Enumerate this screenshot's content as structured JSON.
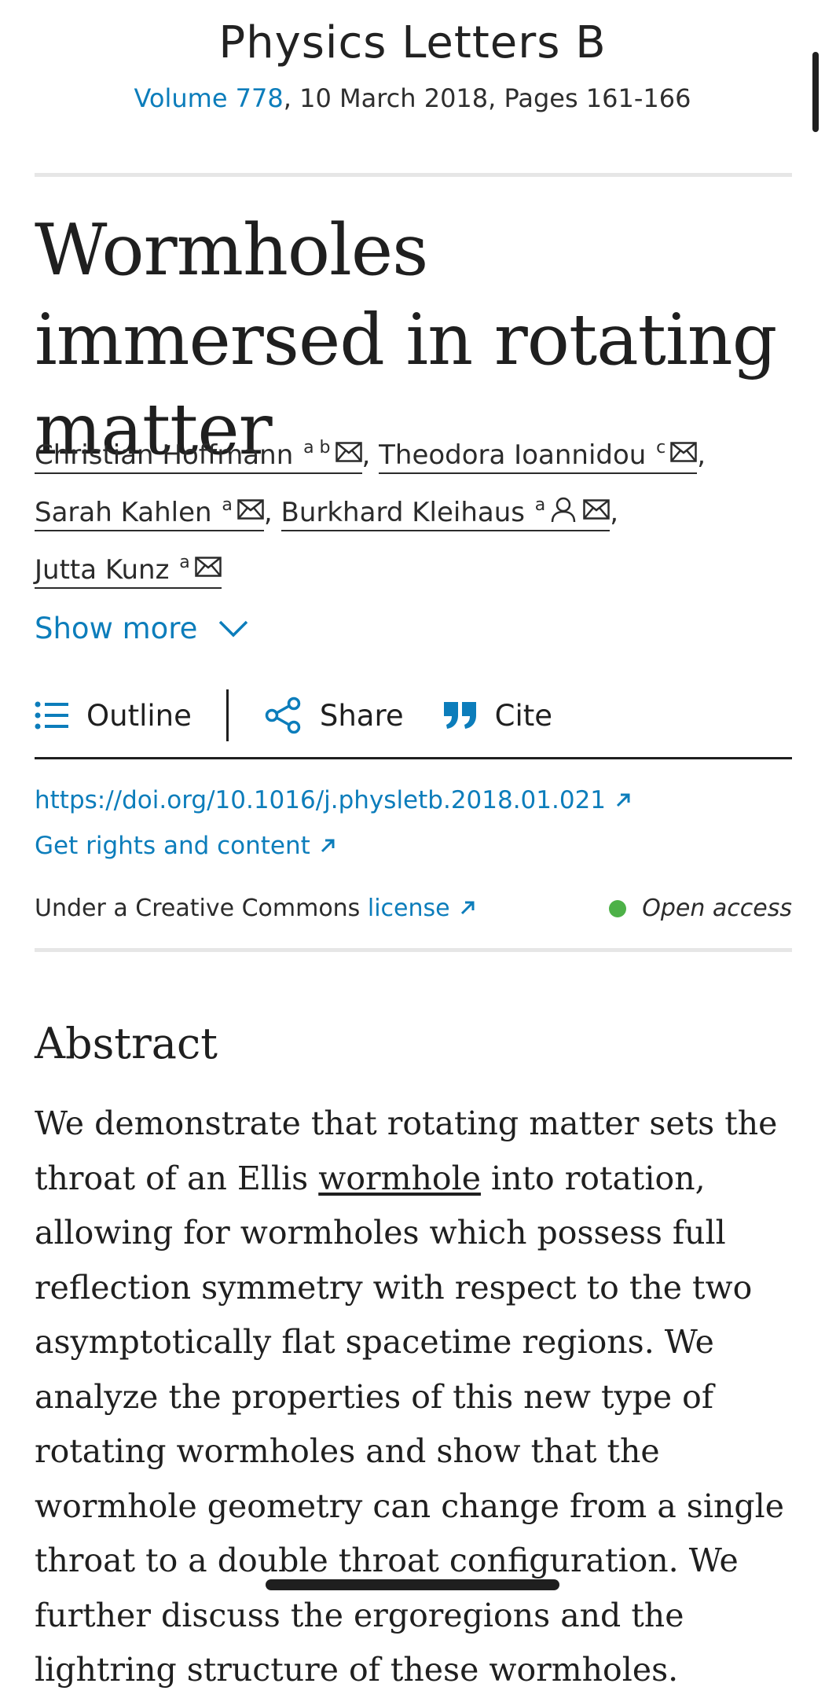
{
  "journal": {
    "name": "Physics Letters B",
    "volume_link": "Volume 778",
    "issue_rest": ", 10 March 2018, Pages 161-166"
  },
  "article": {
    "title": "Wormholes immersed in rotating matter"
  },
  "authors": [
    {
      "name": "Christian Hoffmann",
      "affil": "a b"
    },
    {
      "name": "Theodora Ioannidou",
      "affil": "c"
    },
    {
      "name": "Sarah Kahlen",
      "affil": "a"
    },
    {
      "name": "Burkhard Kleihaus",
      "affil": "a"
    },
    {
      "name": "Jutta Kunz",
      "affil": "a"
    }
  ],
  "show_more": "Show more",
  "toolbar": {
    "outline": "Outline",
    "share": "Share",
    "cite": "Cite"
  },
  "links": {
    "doi": "https://doi.org/10.1016/j.physletb.2018.01.021",
    "rights": "Get rights and content"
  },
  "license": {
    "prefix": "Under a Creative Commons",
    "link": "license",
    "access": "Open access"
  },
  "abstract": {
    "heading": "Abstract",
    "part1": "We demonstrate that rotating matter sets the throat of an Ellis ",
    "term": "wormhole",
    "part2": " into rotation, allowing for wormholes which possess full reflection symmetry with respect to the two asymptotically flat spacetime regions. We analyze the properties of this new type of rotating wormholes and show that the wormhole geometry can change from a single throat to a double throat configuration. We further discuss the ergoregions and the lightring structure of these wormholes."
  },
  "colors": {
    "link": "#0c7dbb",
    "open_access_dot": "#4db148",
    "text": "#1f1f1f"
  }
}
